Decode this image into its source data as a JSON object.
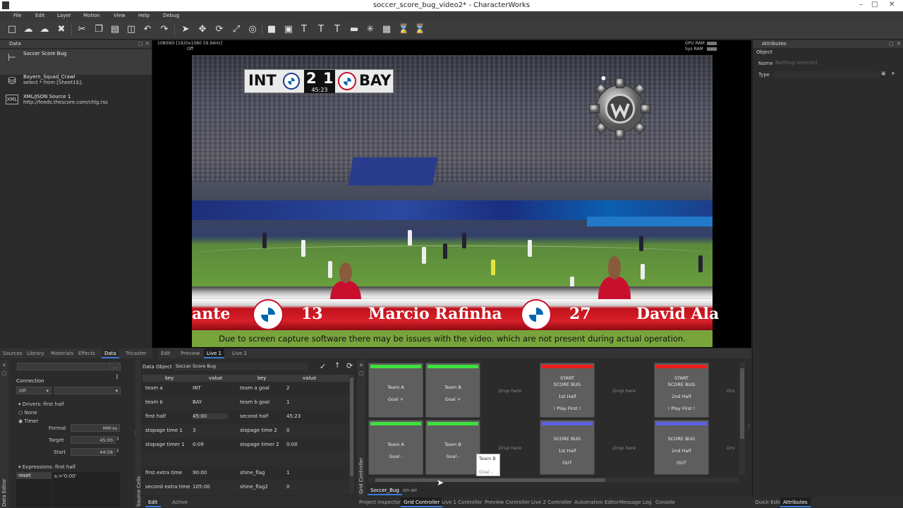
{
  "window": {
    "title": "soccer_score_bug_video2* - CharacterWorks",
    "controls": [
      "–",
      "□",
      "✕"
    ]
  },
  "menu": [
    "File",
    "Edit",
    "Layer",
    "Motion",
    "View",
    "Help",
    "Debug"
  ],
  "data_panel": {
    "title": "Data",
    "sources": [
      {
        "name": "Soccer Score Bug",
        "sub": "",
        "icon": "key-value-icon"
      },
      {
        "name": "Bayern_Squad_Crawl",
        "sub": "select * from [Sheet1$];",
        "icon": "database-icon"
      },
      {
        "name": "XML/JSON Source 1",
        "sub": "http://feeds.thescore.com/chlg.rss",
        "icon": "xml-icon"
      }
    ]
  },
  "viewport": {
    "res": "1080i60 [1920x1080 59.94Hz]",
    "state": "Off",
    "gpu_ram": "GPU RAM",
    "sys_ram": "Sys RAM"
  },
  "scorebug": {
    "team_a": "INT",
    "score_a": "2",
    "score_b": "1",
    "team_b": "BAY",
    "clock": "45:23"
  },
  "crawl": [
    "ante",
    "13",
    "Marcio Rafinha",
    "27",
    "David Ala"
  ],
  "notice": "Due to screen capture software there may be issues with the video. which are not present during actual operation.",
  "attributes": {
    "title": "Attributes",
    "object": "Object",
    "name_label": "Name",
    "name_placeholder": "Nothing selected.",
    "type_label": "Type"
  },
  "left_tabs": [
    "Sources",
    "Library",
    "Materials",
    "Effects",
    "Data",
    "Tricaster"
  ],
  "view_tabs": [
    "Edit",
    "Preview",
    "Live 1",
    "Live 2"
  ],
  "data_editor": {
    "side_label": "Data Editor",
    "connection": "Connection",
    "connection_value": "Off",
    "drivers": "Drivers: first half",
    "none": "None",
    "timer": "Timer",
    "format_label": "Format",
    "format_value": "MM:ss",
    "target_label": "Target",
    "target_value": "45:00",
    "start_label": "Start",
    "start_value": "44:58",
    "expressions": "Expressions: first half",
    "expr_key": "reset",
    "expr_value": "s:='0:00'"
  },
  "data_object": {
    "label": "Data Object",
    "value": "Soccer Score Bug",
    "headers": [
      "key",
      "value",
      "key",
      "value"
    ],
    "source_cells": "Source Cells",
    "rows": [
      [
        "team a",
        "INT",
        "team a goal",
        "2"
      ],
      [
        "team b",
        "BAY",
        "team b goal",
        "1"
      ],
      [
        "first half",
        "45:00",
        "second half",
        "45:23"
      ],
      [
        "stopage time 1",
        "3",
        "stopage time 2",
        "0"
      ],
      [
        "stopage timer 1",
        "0:09",
        "stopage timer 2",
        "0:00"
      ],
      [
        "",
        "",
        "",
        ""
      ],
      [
        "first extra time",
        "90:00",
        "shine_flag",
        "1"
      ],
      [
        "second extra time",
        "105:00",
        "shine_flag2",
        "0"
      ]
    ]
  },
  "bottom_left_tabs": [
    "Edit",
    "Active"
  ],
  "grid": {
    "side_label": "Grid Controller",
    "drop_here": "Drop here",
    "drop_partial": "Dro",
    "row1": [
      {
        "lines": [
          "Team A",
          "Goal +"
        ],
        "color": "#3ee03e"
      },
      {
        "lines": [
          "Team B",
          "Goal +"
        ],
        "color": "#3ee03e"
      },
      {
        "lines": [
          "START",
          "SCORE BUG",
          "1st Half",
          "! Play First !"
        ],
        "color": "#ee1c1c"
      },
      {
        "lines": [
          "START",
          "SCORE BUG",
          "2nd Half",
          "! Play First !"
        ],
        "color": "#ee1c1c"
      }
    ],
    "row2": [
      {
        "lines": [
          "Team A",
          "Goal -"
        ],
        "color": "#3ee03e"
      },
      {
        "lines": [
          "Team B",
          "Goal -"
        ],
        "color": "#3ee03e"
      },
      {
        "lines": [
          "SCORE BUG",
          "1st Half",
          "OUT"
        ],
        "color": "#5a63e6"
      },
      {
        "lines": [
          "SCORE BUG",
          "2nd Half",
          "OUT"
        ],
        "color": "#5a63e6"
      }
    ],
    "tooltip": [
      "Team B",
      "Goal -"
    ],
    "pages": [
      "Soccer_Bug",
      "on-air"
    ]
  },
  "bottom_tabs": [
    "Project Inspector",
    "Grid Controller",
    "Live 1 Controller",
    "Preview Controller",
    "Live 2 Controller",
    "Automation Editor",
    "Message Log",
    "Console"
  ],
  "right_bottom_tabs": [
    "Quick-Edit",
    "Attributes"
  ]
}
